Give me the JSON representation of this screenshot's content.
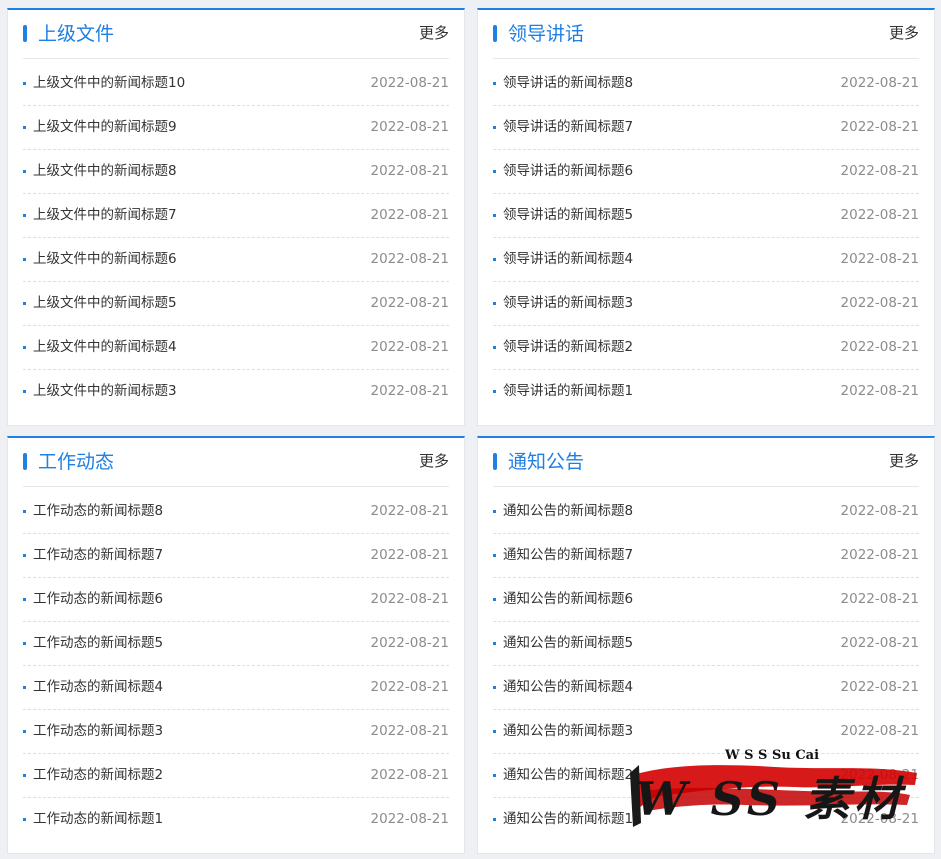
{
  "panels": [
    {
      "title": "上级文件",
      "more": "更多",
      "items": [
        {
          "title": "上级文件中的新闻标题10",
          "date": "2022-08-21"
        },
        {
          "title": "上级文件中的新闻标题9",
          "date": "2022-08-21"
        },
        {
          "title": "上级文件中的新闻标题8",
          "date": "2022-08-21"
        },
        {
          "title": "上级文件中的新闻标题7",
          "date": "2022-08-21"
        },
        {
          "title": "上级文件中的新闻标题6",
          "date": "2022-08-21"
        },
        {
          "title": "上级文件中的新闻标题5",
          "date": "2022-08-21"
        },
        {
          "title": "上级文件中的新闻标题4",
          "date": "2022-08-21"
        },
        {
          "title": "上级文件中的新闻标题3",
          "date": "2022-08-21"
        }
      ]
    },
    {
      "title": "领导讲话",
      "more": "更多",
      "items": [
        {
          "title": "领导讲话的新闻标题8",
          "date": "2022-08-21"
        },
        {
          "title": "领导讲话的新闻标题7",
          "date": "2022-08-21"
        },
        {
          "title": "领导讲话的新闻标题6",
          "date": "2022-08-21"
        },
        {
          "title": "领导讲话的新闻标题5",
          "date": "2022-08-21"
        },
        {
          "title": "领导讲话的新闻标题4",
          "date": "2022-08-21"
        },
        {
          "title": "领导讲话的新闻标题3",
          "date": "2022-08-21"
        },
        {
          "title": "领导讲话的新闻标题2",
          "date": "2022-08-21"
        },
        {
          "title": "领导讲话的新闻标题1",
          "date": "2022-08-21"
        }
      ]
    },
    {
      "title": "工作动态",
      "more": "更多",
      "items": [
        {
          "title": "工作动态的新闻标题8",
          "date": "2022-08-21"
        },
        {
          "title": "工作动态的新闻标题7",
          "date": "2022-08-21"
        },
        {
          "title": "工作动态的新闻标题6",
          "date": "2022-08-21"
        },
        {
          "title": "工作动态的新闻标题5",
          "date": "2022-08-21"
        },
        {
          "title": "工作动态的新闻标题4",
          "date": "2022-08-21"
        },
        {
          "title": "工作动态的新闻标题3",
          "date": "2022-08-21"
        },
        {
          "title": "工作动态的新闻标题2",
          "date": "2022-08-21"
        },
        {
          "title": "工作动态的新闻标题1",
          "date": "2022-08-21"
        }
      ]
    },
    {
      "title": "通知公告",
      "more": "更多",
      "items": [
        {
          "title": "通知公告的新闻标题8",
          "date": "2022-08-21"
        },
        {
          "title": "通知公告的新闻标题7",
          "date": "2022-08-21"
        },
        {
          "title": "通知公告的新闻标题6",
          "date": "2022-08-21"
        },
        {
          "title": "通知公告的新闻标题5",
          "date": "2022-08-21"
        },
        {
          "title": "通知公告的新闻标题4",
          "date": "2022-08-21"
        },
        {
          "title": "通知公告的新闻标题3",
          "date": "2022-08-21"
        },
        {
          "title": "通知公告的新闻标题2",
          "date": "2022-08-21"
        },
        {
          "title": "通知公告的新闻标题1",
          "date": "2022-08-21"
        }
      ]
    }
  ],
  "watermark": {
    "small_text": "W S S Su Cai",
    "big_text": "W SS 素材"
  },
  "colors": {
    "accent": "#1f7fe3",
    "text": "#333333",
    "date": "#8c8c8c",
    "background": "#eef0f3",
    "watermark_brush": "#d40000"
  }
}
